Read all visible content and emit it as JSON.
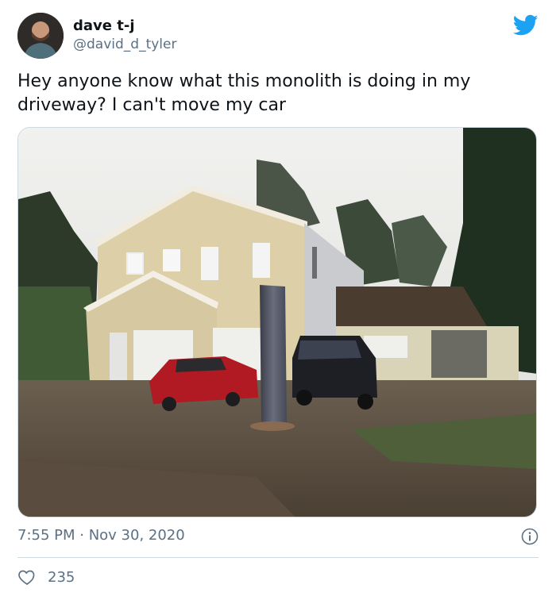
{
  "user": {
    "name": "dave t-j",
    "handle": "@david_d_tyler"
  },
  "tweet": {
    "text": "Hey anyone know what this monolith is doing in my driveway? I can't move my car",
    "timestamp": "7:55 PM · Nov 30, 2020",
    "likes": "235"
  },
  "icons": {
    "brand": "twitter-bird-icon",
    "info": "info-icon",
    "like": "heart-icon"
  },
  "colors": {
    "brand": "#1da1f2",
    "secondary_text": "#5b7083",
    "primary_text": "#0f1419"
  }
}
